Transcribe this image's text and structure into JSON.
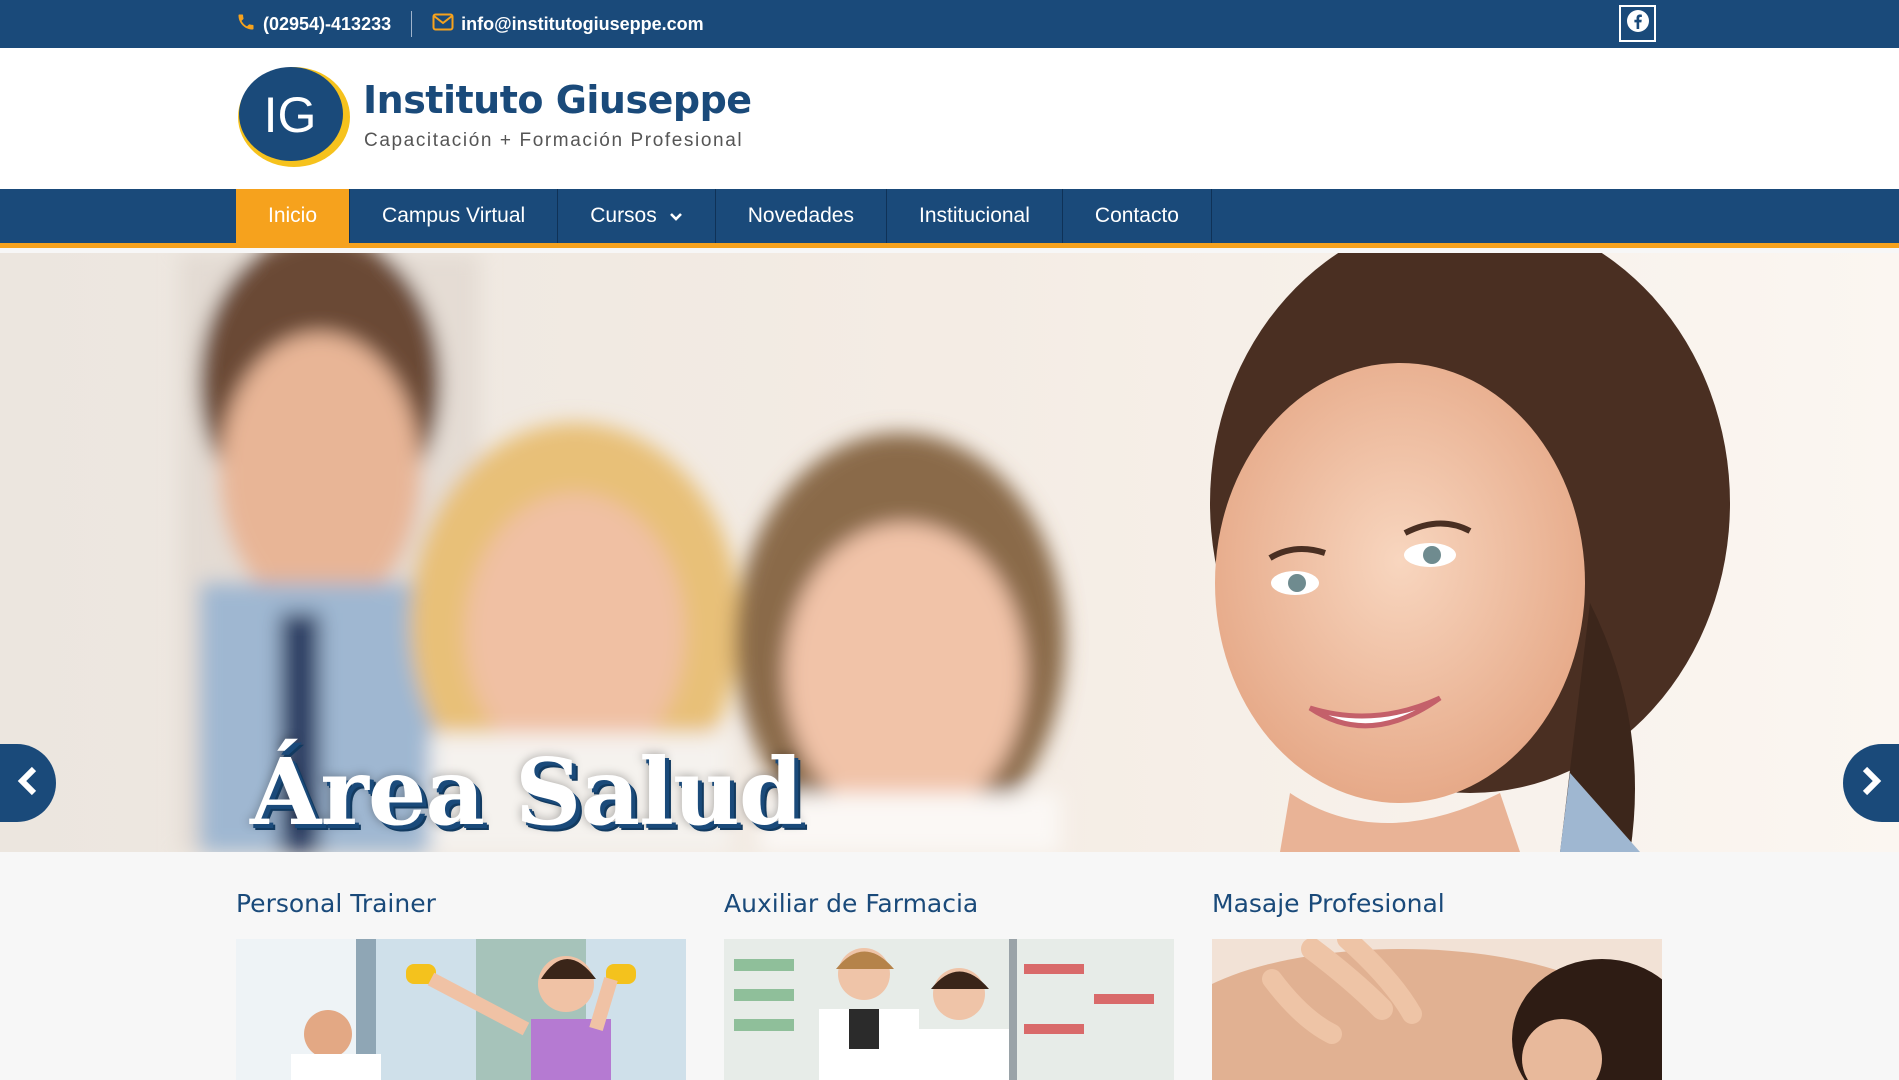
{
  "topbar": {
    "phone": "(02954)-413233",
    "email": "info@institutogiuseppe.com",
    "social_icon": "facebook-icon"
  },
  "header": {
    "logo_text": "IG",
    "title": "Instituto Giuseppe",
    "subtitle": "Capacitación + Formación Profesional"
  },
  "nav": {
    "items": [
      {
        "label": "Inicio",
        "active": true
      },
      {
        "label": "Campus Virtual"
      },
      {
        "label": "Cursos",
        "has_dropdown": true
      },
      {
        "label": "Novedades"
      },
      {
        "label": "Institucional"
      },
      {
        "label": "Contacto"
      }
    ]
  },
  "slider": {
    "caption": "Área Salud",
    "prev_icon": "chevron-left-icon",
    "next_icon": "chevron-right-icon"
  },
  "courses": [
    {
      "title": "Personal Trainer"
    },
    {
      "title": "Auxiliar de Farmacia"
    },
    {
      "title": "Masaje Profesional"
    }
  ],
  "colors": {
    "primary": "#1a4a7a",
    "accent": "#f6a21d",
    "white": "#ffffff"
  }
}
